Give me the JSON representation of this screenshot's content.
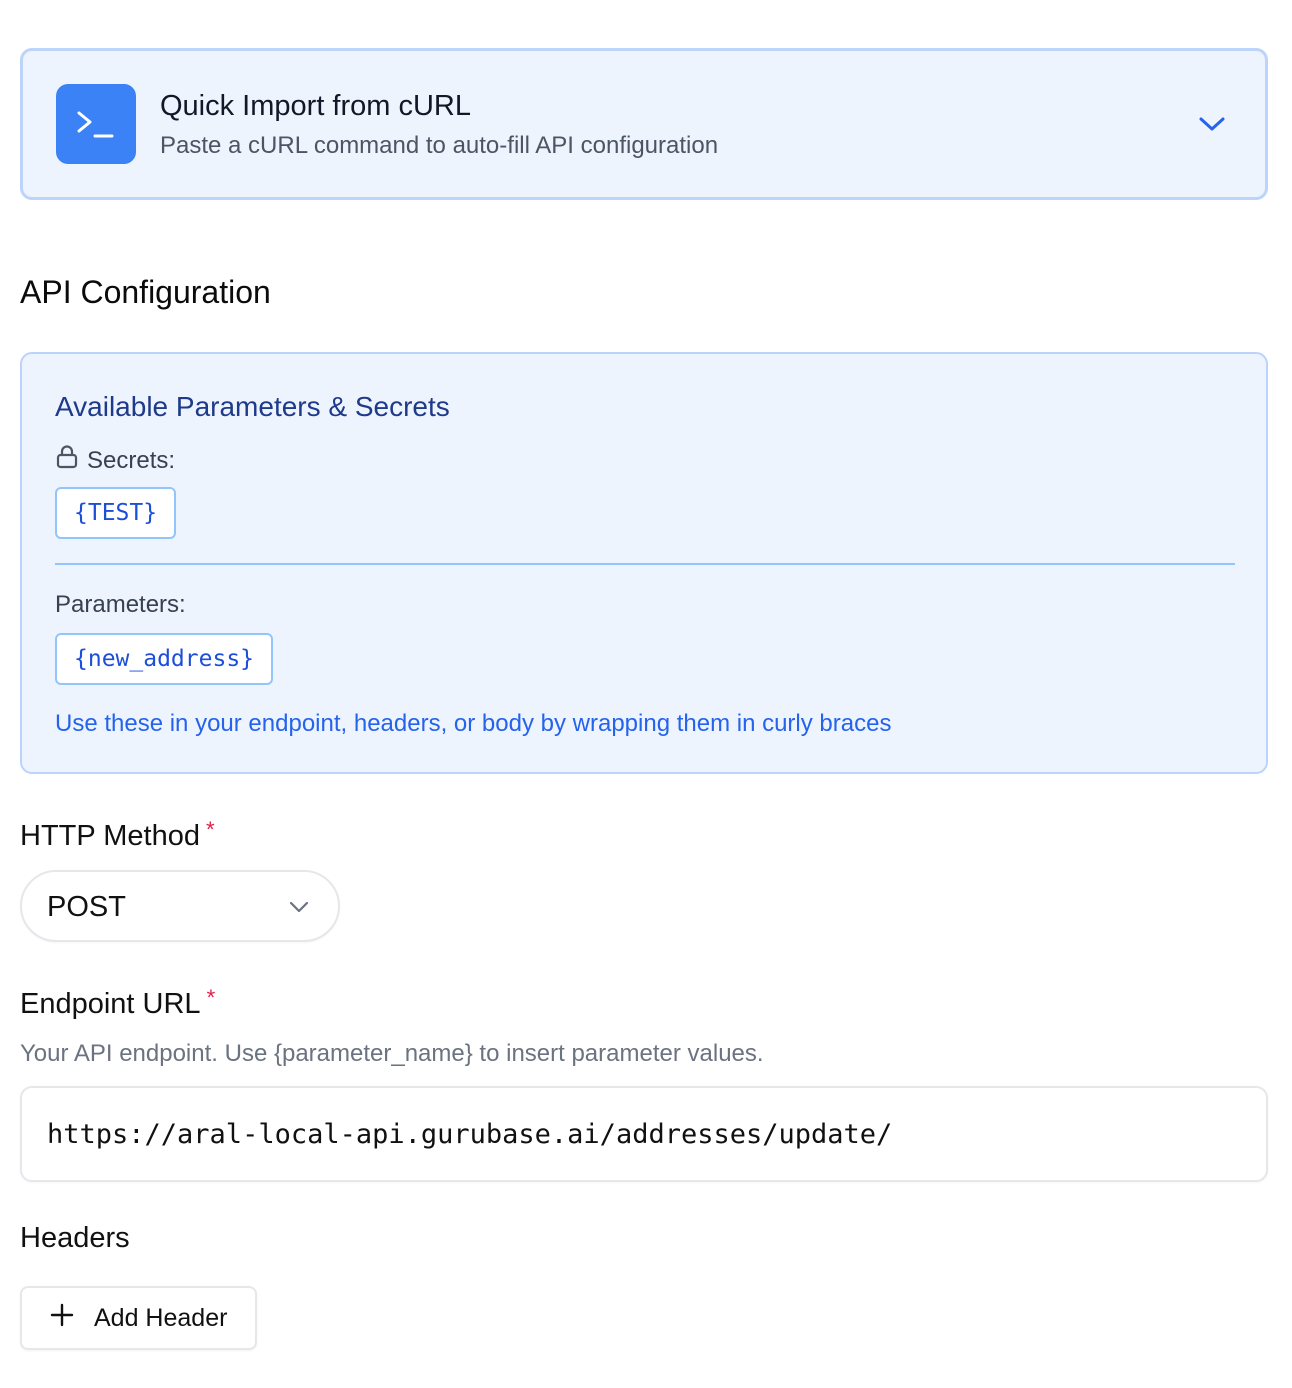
{
  "quick_import": {
    "title": "Quick Import from cURL",
    "subtitle": "Paste a cURL command to auto-fill API configuration",
    "icon": "terminal-icon",
    "expand_icon": "chevron-down-icon"
  },
  "section": {
    "title": "API Configuration"
  },
  "available": {
    "title": "Available Parameters & Secrets",
    "secrets_label": "Secrets:",
    "secrets": [
      "{TEST}"
    ],
    "parameters_label": "Parameters:",
    "parameters": [
      "{new_address}"
    ],
    "hint": "Use these in your endpoint, headers, or body by wrapping them in curly braces"
  },
  "http_method": {
    "label": "HTTP Method",
    "required_mark": "*",
    "value": "POST"
  },
  "endpoint": {
    "label": "Endpoint URL",
    "required_mark": "*",
    "help": "Your API endpoint. Use {parameter_name} to insert parameter values.",
    "value": "https://aral-local-api.gurubase.ai/addresses/update/"
  },
  "headers": {
    "label": "Headers",
    "add_label": "Add Header"
  },
  "colors": {
    "accent": "#3b82f6",
    "card_bg": "#eef4fe",
    "card_border": "#bcd4fa",
    "chip_text": "#1d4ed8",
    "required": "#e11d48"
  }
}
